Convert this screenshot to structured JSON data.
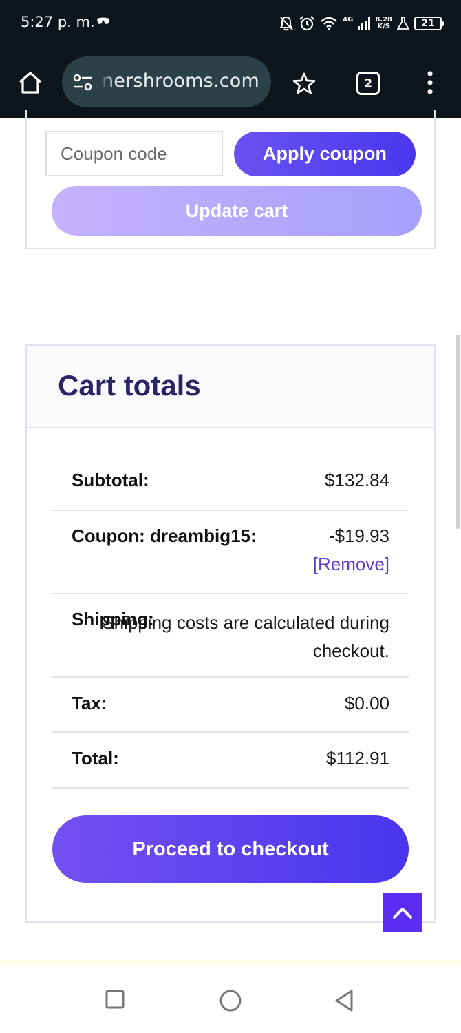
{
  "status_bar": {
    "time": "5:27 p. m.",
    "network": "4G",
    "speed_value": "8.28",
    "speed_unit": "K/S",
    "battery": "21"
  },
  "browser": {
    "url": "nershrooms.com",
    "tab_count": "2",
    "icons": [
      "home-icon",
      "site-settings-icon",
      "bookmark-star-icon",
      "tab-switcher-icon",
      "overflow-menu-icon"
    ]
  },
  "coupon": {
    "placeholder": "Coupon code",
    "apply_label": "Apply coupon",
    "update_label": "Update cart"
  },
  "cart_totals": {
    "title": "Cart totals",
    "subtotal_label": "Subtotal:",
    "subtotal_value": "$132.84",
    "coupon_label": "Coupon: dreambig15:",
    "coupon_value": "-$19.93",
    "remove_label": "[Remove]",
    "shipping_label": "Shipping:",
    "shipping_value": "Shipping costs are calculated during checkout.",
    "tax_label": "Tax:",
    "tax_value": "$0.00",
    "total_label": "Total:",
    "total_value": "$112.91",
    "checkout_label": "Proceed to checkout"
  },
  "colors": {
    "accent": "#4a36ef",
    "accent_light": "#b6a9fd",
    "title": "#2a2566",
    "link": "#5a3fc9",
    "chrome": "#0d161c"
  },
  "nav_bar": {
    "icons": [
      "recents-square-icon",
      "home-circle-icon",
      "back-triangle-icon"
    ]
  }
}
